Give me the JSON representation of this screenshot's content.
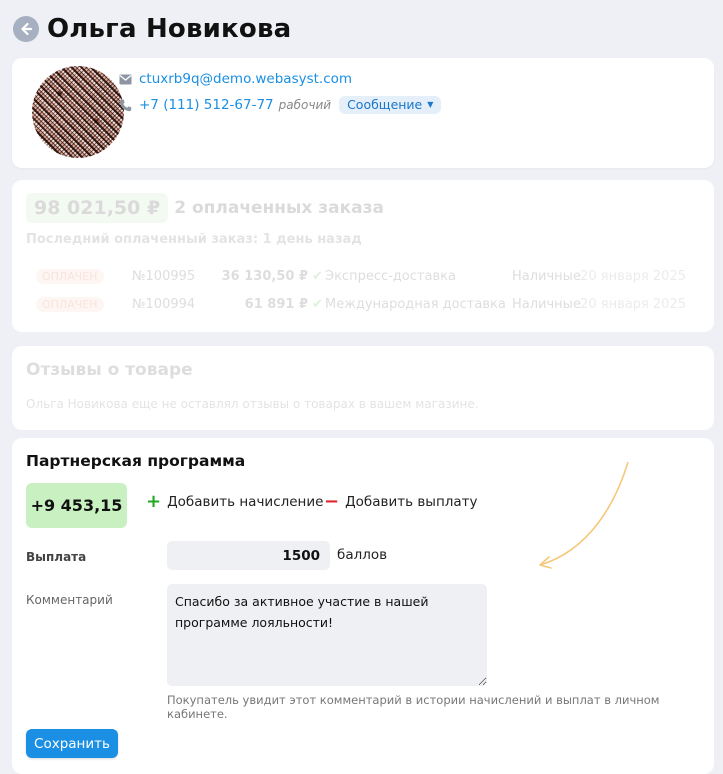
{
  "header": {
    "title": "Ольга Новикова"
  },
  "contact": {
    "email": "ctuxrb9q@demo.webasyst.com",
    "phone": "+7 (111) 512-67-77",
    "phone_type": "рабочий",
    "message_button": "Сообщение"
  },
  "orders": {
    "total": "98 021,50 ₽",
    "count_label": "2 оплаченных заказа",
    "last_paid": "Последний оплаченный заказ: 1 день назад",
    "rows": [
      {
        "status": "ОПЛАЧЕН",
        "number": "№100995",
        "sum": "36 130,50 ₽",
        "shipping": "Экспресс-доставка",
        "payment": "Наличные",
        "date": "20 января 2025"
      },
      {
        "status": "ОПЛАЧЕН",
        "number": "№100994",
        "sum": "61 891 ₽",
        "shipping": "Международная доставка",
        "payment": "Наличные",
        "date": "20 января 2025"
      }
    ]
  },
  "reviews": {
    "title": "Отзывы о товаре",
    "empty_text": "Ольга Новикова еще не оставлял отзывы о товарах в вашем магазине."
  },
  "affiliate": {
    "title": "Партнерская программа",
    "balance": "+9 453,15",
    "add_accrual_label": "Добавить начисление",
    "add_payout_label": "Добавить выплату",
    "payout_label": "Выплата",
    "payout_value": "1500",
    "payout_unit": "баллов",
    "comment_label": "Комментарий",
    "comment_value": "Спасибо за активное участие в нашей программе лояльности!",
    "hint": "Покупатель увидит этот комментарий в истории начислений и выплат в личном кабинете.",
    "save_label": "Сохранить"
  },
  "colors": {
    "accent": "#1a8fe3",
    "balance_bg": "#c8f0c1",
    "plus": "#22aa22",
    "minus": "#e0242c",
    "arrow": "#f5c87a"
  },
  "icons": {
    "back": "arrow-left-circle-icon",
    "email": "envelope-icon",
    "phone": "phone-icon",
    "paid": "check-circle-icon",
    "plus": "plus-icon",
    "minus": "minus-icon"
  }
}
